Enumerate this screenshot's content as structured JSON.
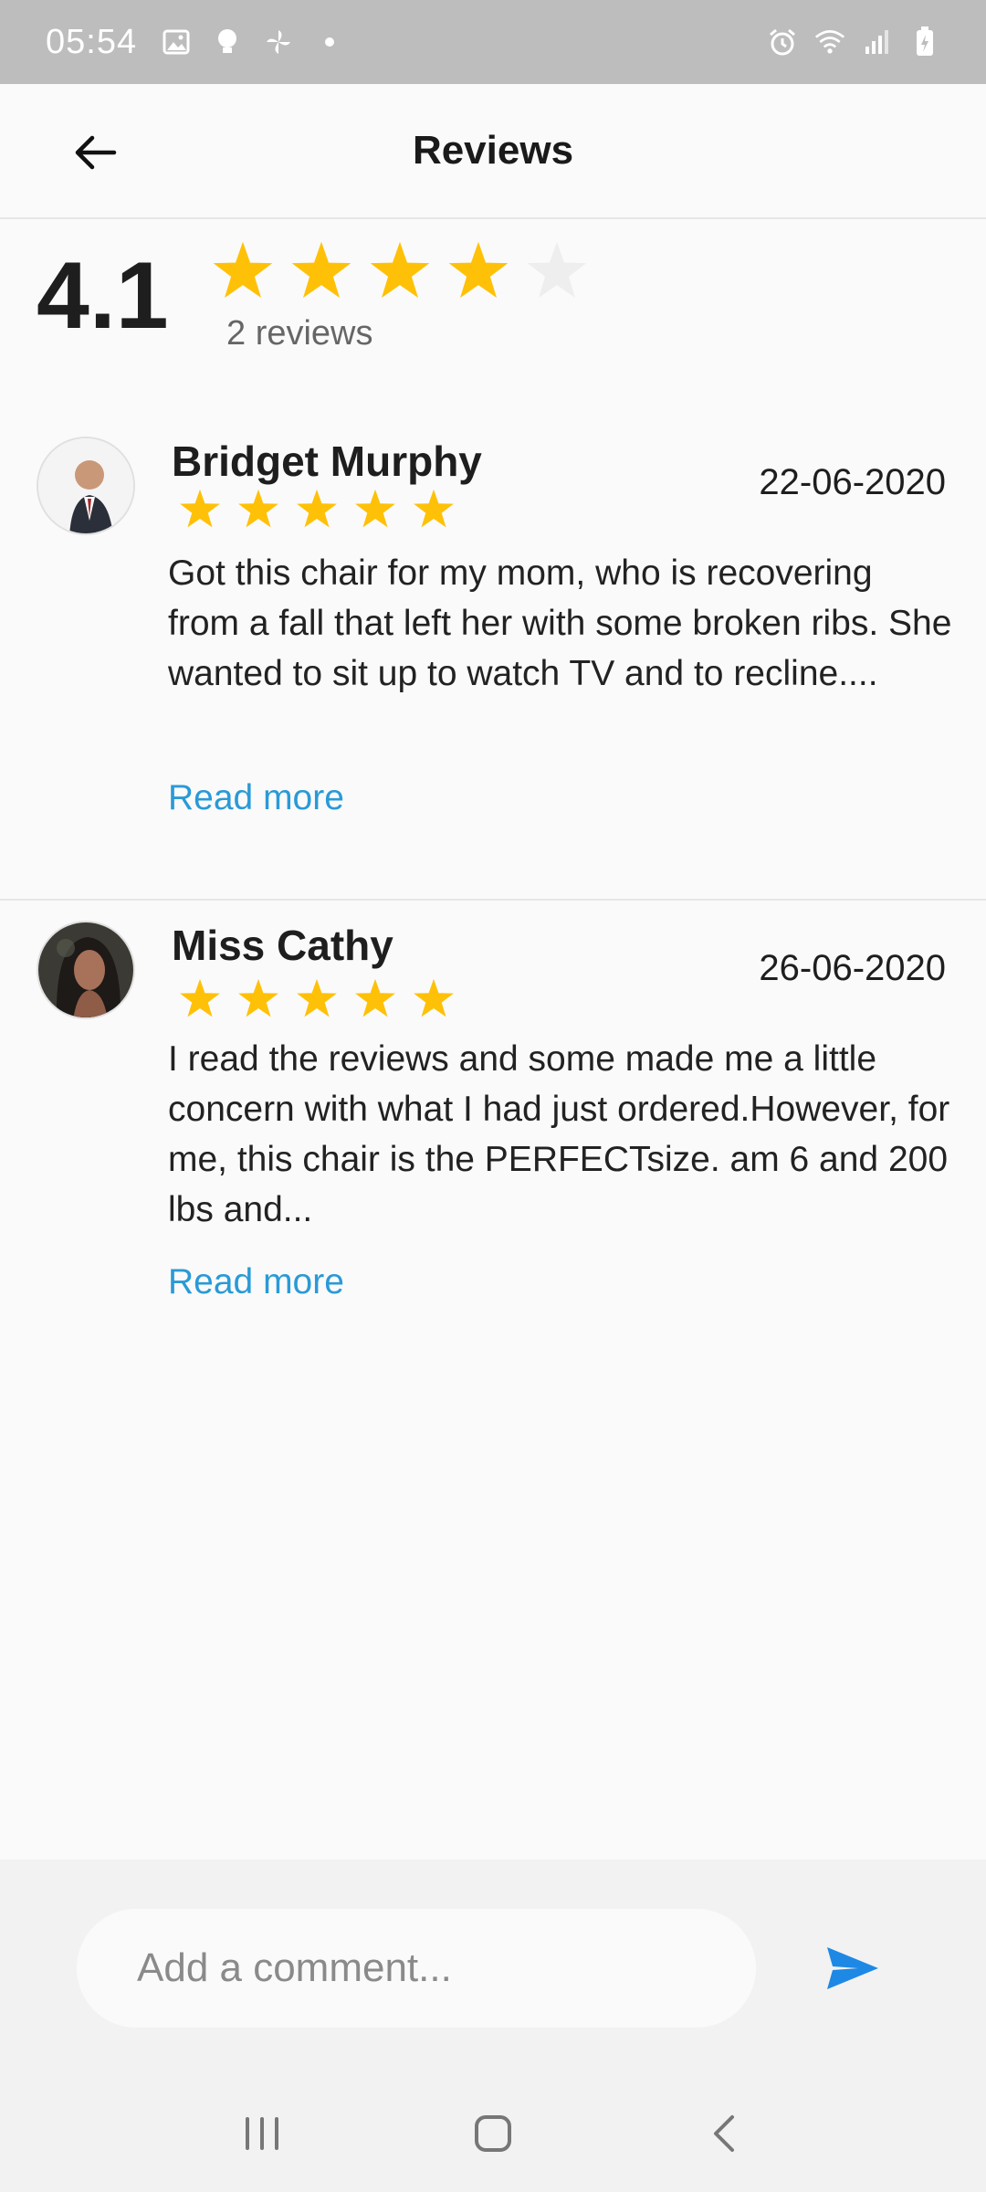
{
  "status_bar": {
    "time": "05:54",
    "left_icons": [
      "image-icon",
      "bulb-icon",
      "fan-icon",
      "dot-icon"
    ],
    "right_icons": [
      "alarm-icon",
      "wifi-icon",
      "signal-icon",
      "battery-icon"
    ]
  },
  "header": {
    "title": "Reviews",
    "back_icon": "arrow-left-icon"
  },
  "summary": {
    "average": "4.1",
    "stars_filled": 4,
    "stars_total": 5,
    "count_label": "2 reviews"
  },
  "reviews": [
    {
      "name": "Bridget Murphy",
      "date": "22-06-2020",
      "rating": 5,
      "text": "Got this chair for my mom, who is recovering from a fall that left her with some broken ribs. She wanted to sit up to watch TV and to recline....",
      "read_more": "Read more"
    },
    {
      "name": "Miss Cathy",
      "date": "26-06-2020",
      "rating": 5,
      "text": "I read the reviews and some made me a little concern with what I had just ordered.However, for me, this chair is the PERFECTsize. am 6 and 200 lbs and...",
      "read_more": "Read more"
    }
  ],
  "comment": {
    "placeholder": "Add a comment...",
    "value": ""
  },
  "nav": {
    "icons": [
      "recent-apps-icon",
      "home-icon",
      "back-icon"
    ]
  },
  "colors": {
    "star_filled": "#FFC107",
    "star_empty": "#EEEEEE",
    "link": "#2A9AD6",
    "send": "#1E88E5",
    "status_bar": "#BDBDBD"
  }
}
